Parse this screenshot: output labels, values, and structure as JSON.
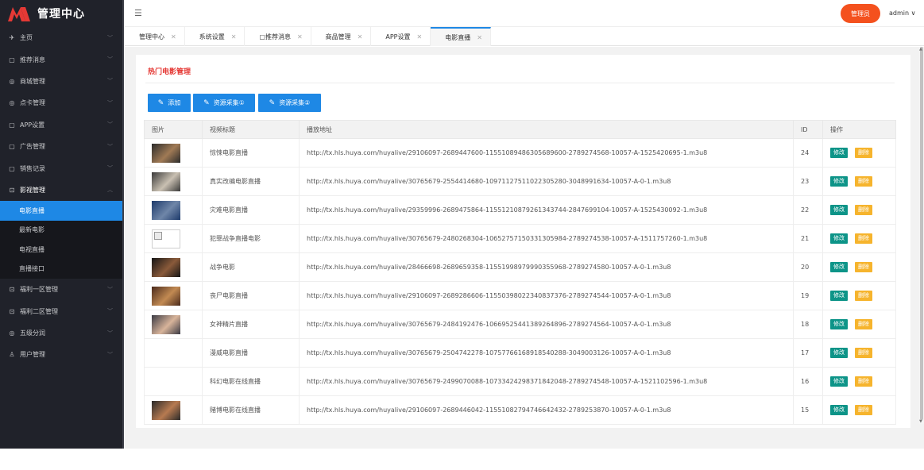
{
  "brand": {
    "title": "管理中心",
    "logo_colors": [
      "#e53935",
      "#ffffff"
    ]
  },
  "header": {
    "admin_button": "管理员",
    "user": "admin ∨"
  },
  "sidebar": {
    "items": [
      {
        "icon": "send-icon",
        "glyph": "✈",
        "label": "主页",
        "expanded": false
      },
      {
        "icon": "square-icon",
        "glyph": "▢",
        "label": "推荐消息",
        "expanded": false
      },
      {
        "icon": "globe-icon",
        "glyph": "◎",
        "label": "商城管理",
        "expanded": false
      },
      {
        "icon": "globe-icon",
        "glyph": "◎",
        "label": "点卡管理",
        "expanded": false
      },
      {
        "icon": "square-icon",
        "glyph": "▢",
        "label": "APP设置",
        "expanded": false
      },
      {
        "icon": "square-icon",
        "glyph": "▢",
        "label": "广告管理",
        "expanded": false
      },
      {
        "icon": "square-icon",
        "glyph": "▢",
        "label": "销售记录",
        "expanded": false
      },
      {
        "icon": "video-icon",
        "glyph": "⊡",
        "label": "影视管理",
        "expanded": true
      }
    ],
    "subitems": [
      {
        "label": "电影直播",
        "active": true
      },
      {
        "label": "最新电影",
        "active": false
      },
      {
        "label": "电视直播",
        "active": false
      },
      {
        "label": "直播接口",
        "active": false
      }
    ],
    "items_after": [
      {
        "icon": "video-icon",
        "glyph": "⊡",
        "label": "福利一区管理"
      },
      {
        "icon": "video-icon",
        "glyph": "⊡",
        "label": "福利二区管理"
      },
      {
        "icon": "globe-icon",
        "glyph": "◎",
        "label": "五级分润"
      },
      {
        "icon": "user-icon",
        "glyph": "♙",
        "label": "用户管理"
      }
    ]
  },
  "tabs": [
    {
      "label": "管理中心",
      "active": false
    },
    {
      "label": "系统设置",
      "active": false
    },
    {
      "label": "推荐消息",
      "active": false,
      "prefix": "▢ "
    },
    {
      "label": "商品管理",
      "active": false
    },
    {
      "label": "APP设置",
      "active": false
    },
    {
      "label": "电影直播",
      "active": true
    }
  ],
  "panel": {
    "title": "热门电影管理",
    "buttons": [
      "添加",
      "资源采集①",
      "资源采集②"
    ]
  },
  "table": {
    "headers": [
      "图片",
      "视频标题",
      "播放地址",
      "ID",
      "操作"
    ],
    "edit_label": "修改",
    "delete_label": "删除",
    "rows": [
      {
        "thumb": "photo",
        "thumb_colors": [
          "#2b2b2b",
          "#a07a55"
        ],
        "title": "惊悚电影直播",
        "url": "http://tx.hls.huya.com/huyalive/29106097-2689447600-11551089486305689600-2789274568-10057-A-1525420695-1.m3u8",
        "id": "24"
      },
      {
        "thumb": "photo",
        "thumb_colors": [
          "#3a3a3a",
          "#c9c0b2"
        ],
        "title": "真实改编电影直播",
        "url": "http://tx.hls.huya.com/huyalive/30765679-2554414680-10971127511022305280-3048991634-10057-A-0-1.m3u8",
        "id": "23"
      },
      {
        "thumb": "photo",
        "thumb_colors": [
          "#1d3a6b",
          "#6f86a8"
        ],
        "title": "灾难电影直播",
        "url": "http://tx.hls.huya.com/huyalive/29359996-2689475864-11551210879261343744-2847699104-10057-A-1525430092-1.m3u8",
        "id": "22"
      },
      {
        "thumb": "broken",
        "thumb_colors": [
          "#ffffff",
          "#cccccc"
        ],
        "title": "犯罪战争直播电影",
        "url": "http://tx.hls.huya.com/huyalive/30765679-2480268304-10652757150331305984-2789274538-10057-A-1511757260-1.m3u8",
        "id": "21"
      },
      {
        "thumb": "photo",
        "thumb_colors": [
          "#151515",
          "#8a5a3a"
        ],
        "title": "战争电影",
        "url": "http://tx.hls.huya.com/huyalive/28466698-2689659358-11551998979990355968-2789274580-10057-A-0-1.m3u8",
        "id": "20"
      },
      {
        "thumb": "photo",
        "thumb_colors": [
          "#4a2a1c",
          "#c28a52"
        ],
        "title": "丧尸电影直播",
        "url": "http://tx.hls.huya.com/huyalive/29106097-2689286606-11550398022340837376-2789274544-10057-A-0-1.m3u8",
        "id": "19"
      },
      {
        "thumb": "photo",
        "thumb_colors": [
          "#3a3a44",
          "#d8b49a"
        ],
        "title": "女神精片直播",
        "url": "http://tx.hls.huya.com/huyalive/30765679-2484192476-10669525441389264896-2789274564-10057-A-0-1.m3u8",
        "id": "18"
      },
      {
        "thumb": "none",
        "thumb_colors": [
          "#ffffff",
          "#ffffff"
        ],
        "title": "漫威电影直播",
        "url": "http://tx.hls.huya.com/huyalive/30765679-2504742278-10757766168918540288-3049003126-10057-A-0-1.m3u8",
        "id": "17"
      },
      {
        "thumb": "none",
        "thumb_colors": [
          "#ffffff",
          "#ffffff"
        ],
        "title": "科幻电影在线直播",
        "url": "http://tx.hls.huya.com/huyalive/30765679-2499070088-10733424298371842048-2789274548-10057-A-1521102596-1.m3u8",
        "id": "16"
      },
      {
        "thumb": "photo",
        "thumb_colors": [
          "#2a2a2a",
          "#b77a50"
        ],
        "title": "赌博电影在线直播",
        "url": "http://tx.hls.huya.com/huyalive/29106097-2689446042-11551082794746642432-2789253870-10057-A-0-1.m3u8",
        "id": "15"
      }
    ]
  },
  "colors": {
    "accent": "#1e88e5",
    "sidebar": "#20222a",
    "title_red": "#e53935",
    "edit": "#0d9488",
    "delete": "#f6b42d",
    "admin": "#f4511e"
  }
}
